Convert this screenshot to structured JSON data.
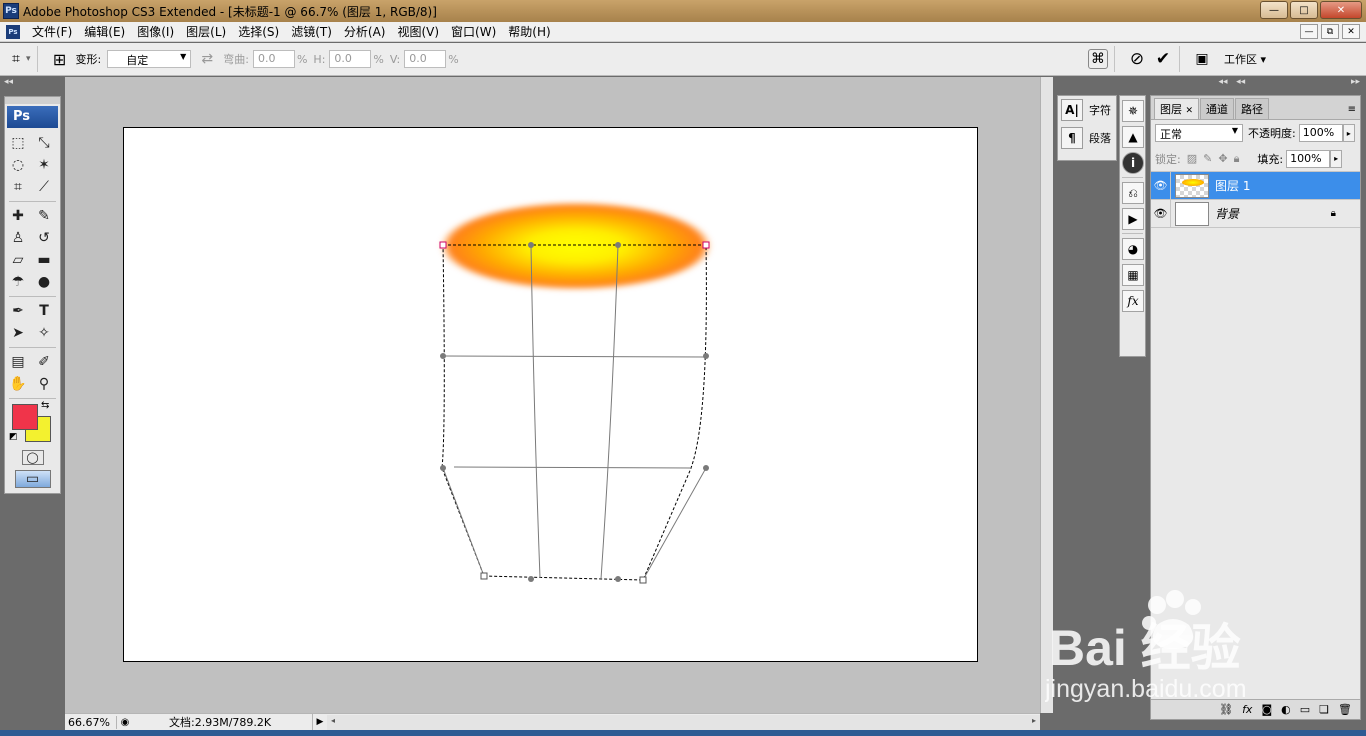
{
  "window": {
    "title": "Adobe Photoshop CS3 Extended - [未标题-1 @ 66.7% (图层 1, RGB/8)]",
    "minimize": "—",
    "maximize": "□",
    "close": "✕"
  },
  "menu": [
    "文件(F)",
    "编辑(E)",
    "图像(I)",
    "图层(L)",
    "选择(S)",
    "滤镜(T)",
    "分析(A)",
    "视图(V)",
    "窗口(W)",
    "帮助(H)"
  ],
  "options": {
    "transform_label": "变形:",
    "transform_value": "自定",
    "bend_label": "弯曲:",
    "bend_value": "0.0",
    "h_label": "H:",
    "h_value": "0.0",
    "v_label": "V:",
    "v_value": "0.0",
    "percent": "%",
    "workspace_label": "工作区 ▾"
  },
  "toolbox": {
    "logo": "Ps",
    "foreground_color": "#f0344a",
    "background_color": "#f3f12f"
  },
  "status": {
    "zoom": "66.67%",
    "doc": "文档:2.93M/789.2K"
  },
  "side_dock": {
    "character": "字符",
    "paragraph": "段落"
  },
  "layers_panel": {
    "tabs": [
      "图层",
      "通道",
      "路径"
    ],
    "blend_mode": "正常",
    "opacity_label": "不透明度:",
    "opacity": "100%",
    "lock_label": "锁定:",
    "fill_label": "填充:",
    "fill": "100%",
    "layers": [
      {
        "name": "图层 1",
        "active": true
      },
      {
        "name": "背景",
        "active": false
      }
    ]
  },
  "watermark": {
    "brand": "Bai 经验",
    "url": "jingyan.baidu.com"
  },
  "colors": {
    "selection": "#3c8eea",
    "title_bar": "#b8925a"
  }
}
